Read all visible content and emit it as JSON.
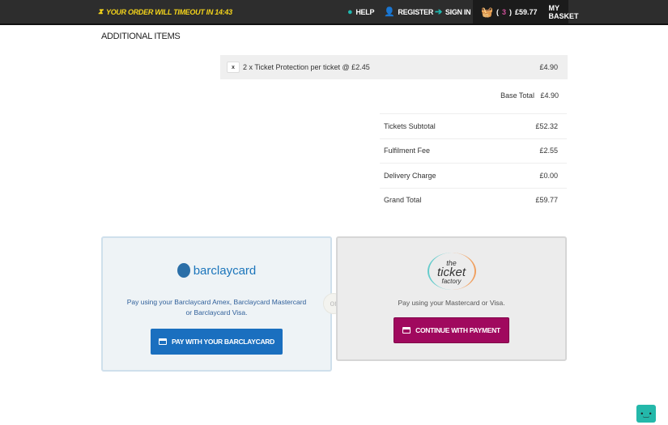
{
  "header": {
    "timer": "YOUR ORDER WILL TIMEOUT IN 14:43",
    "help": "HELP",
    "register": "REGISTER",
    "sign_in": "SIGN IN",
    "basket_open": "(",
    "basket_count": "3",
    "basket_close": ")",
    "basket_total": "£59.77",
    "my_basket": "MY BASKET"
  },
  "section_title": "ADDITIONAL ITEMS",
  "item": {
    "remove": "x",
    "label": "2 x Ticket Protection per ticket @ £2.45",
    "amount": "£4.90"
  },
  "base_total": {
    "label": "Base Total",
    "value": "£4.90"
  },
  "totals": [
    {
      "label": "Tickets Subtotal",
      "value": "£52.32"
    },
    {
      "label": "Fulfilment Fee",
      "value": "£2.55"
    },
    {
      "label": "Delivery Charge",
      "value": "£0.00"
    },
    {
      "label": "Grand Total",
      "value": "£59.77"
    }
  ],
  "barclaycard": {
    "logo": "barclaycard",
    "desc": "Pay using your Barclaycard Amex, Barclaycard Mastercard or Barclaycard Visa.",
    "button": "PAY WITH YOUR BARCLAYCARD"
  },
  "or": "or",
  "ticketfactory": {
    "logo": "the ticket factory",
    "logo_1": "the",
    "logo_2": "ticket",
    "logo_3": "factory",
    "desc": "Pay using your Mastercard or Visa.",
    "button": "CONTINUE WITH PAYMENT"
  },
  "colors": {
    "header": "#2d2d2d",
    "timer": "#f3d31b",
    "accent": "#1fb8b0",
    "barclay_btn": "#1a6fbf",
    "tf_btn": "#a0095e"
  }
}
